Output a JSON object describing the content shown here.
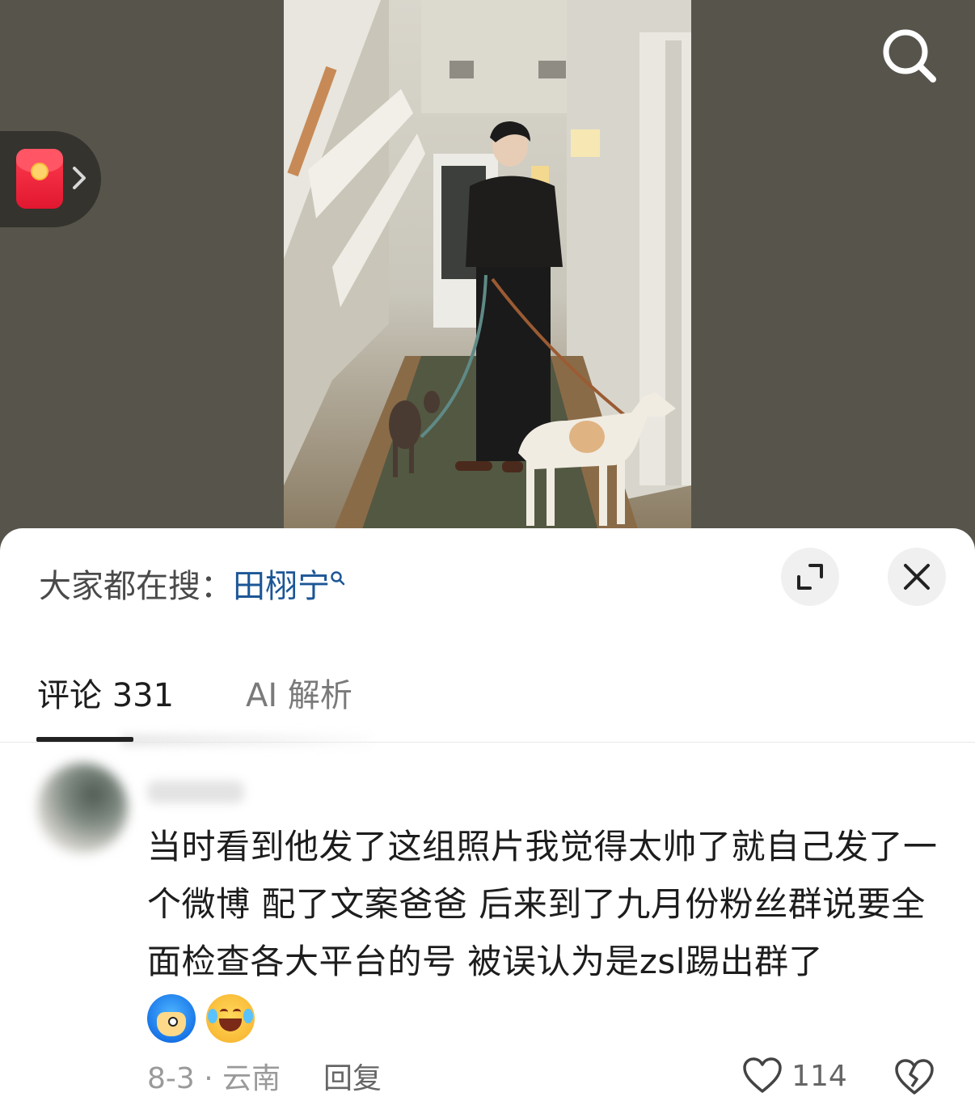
{
  "hot_search": {
    "prefix": "大家都在搜：",
    "term": "田栩宁"
  },
  "tabs": [
    {
      "label": "评论 331",
      "active": true
    },
    {
      "label": "AI 解析",
      "active": false
    }
  ],
  "comment": {
    "text": "当时看到他发了这组照片我觉得太帅了就自己发了一个微博 配了文案爸爸 后来到了九月份粉丝群说要全面检查各大平台的号 被误认为是zsl踢出群了",
    "emojis": [
      "blue-character-emoji",
      "laugh-cry-emoji"
    ],
    "meta": "8-3 · 云南",
    "reply_label": "回复",
    "like_count": "114"
  },
  "colors": {
    "link": "#1c5696",
    "background": "#56534a",
    "red_packet": "#e11730"
  }
}
